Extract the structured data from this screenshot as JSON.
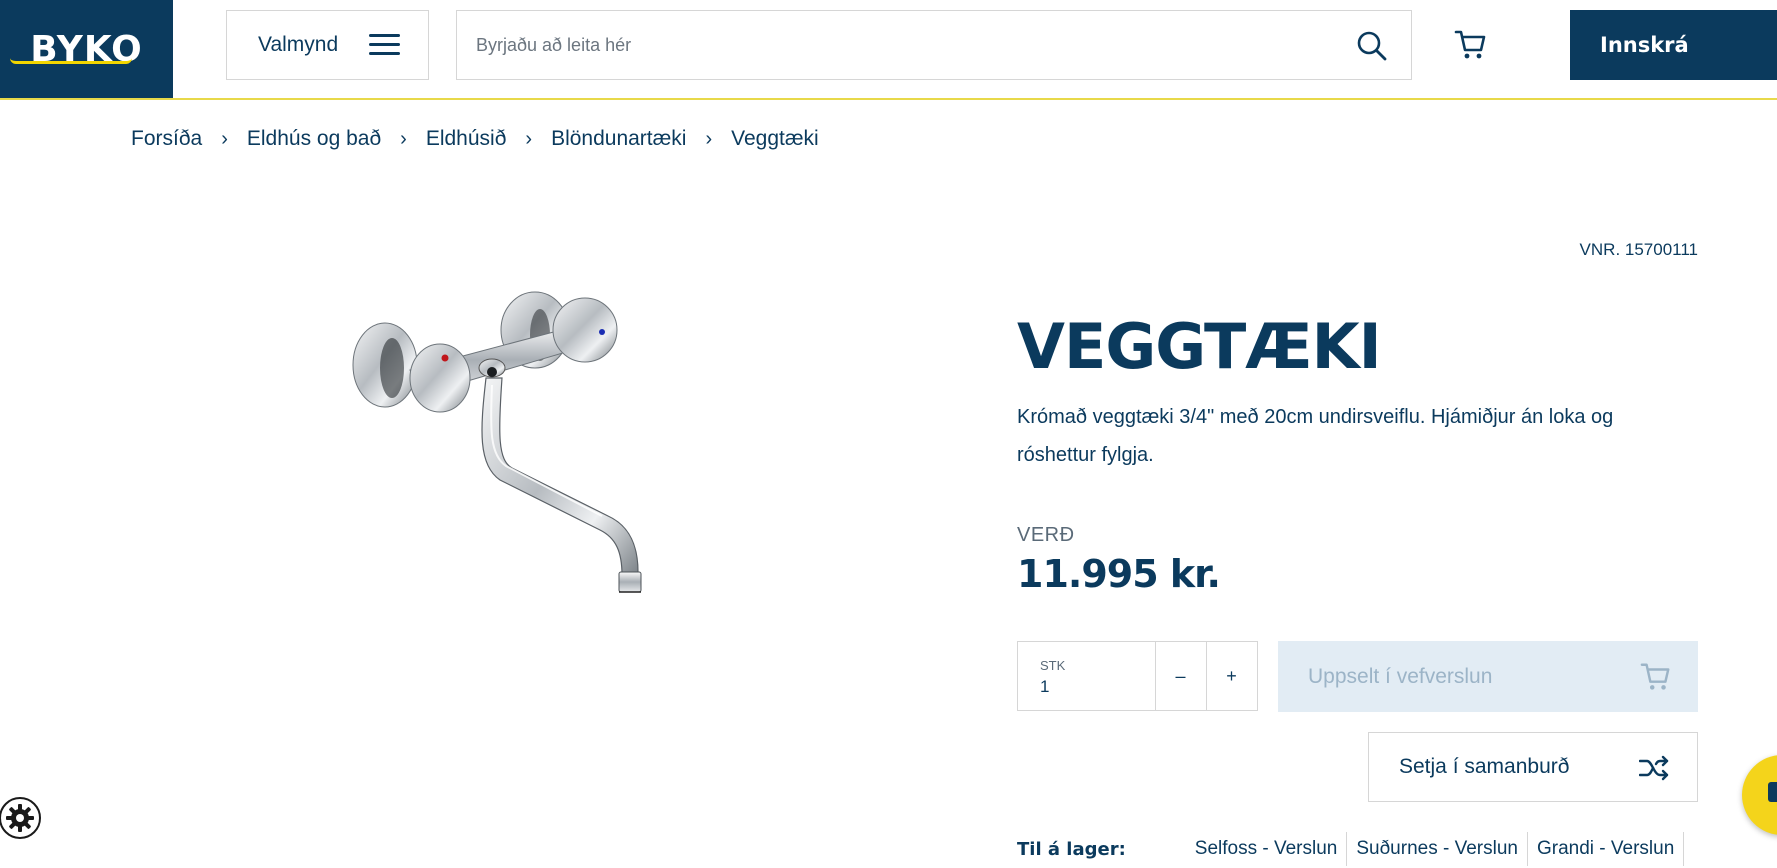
{
  "header": {
    "logo_text": "BYKO",
    "menu_label": "Valmynd",
    "search_placeholder": "Byrjaðu að leita hér",
    "login_label": "Innskrá"
  },
  "breadcrumb": [
    "Forsíða",
    "Eldhús og bað",
    "Eldhúsið",
    "Blöndunartæki",
    "Veggtæki"
  ],
  "product": {
    "vnr": "VNR. 15700111",
    "title": "VEGGTÆKI",
    "description": "Krómað veggtæki 3/4\" með 20cm undirsveiflu. Hjámiðjur án loka og róshettur fylgja.",
    "price_label": "VERÐ",
    "price": "11.995 kr."
  },
  "quantity": {
    "label": "STK",
    "value": "1",
    "minus": "–",
    "plus": "+"
  },
  "buttons": {
    "soldout": "Uppselt í vefverslun",
    "compare": "Setja í samanburð"
  },
  "stock": {
    "label": "Til á lager:",
    "stores": [
      "Selfoss - Verslun",
      "Suðurnes - Verslun",
      "Grandi - Verslun"
    ]
  },
  "colors": {
    "brand": "#0b3a5d",
    "accent": "#f4d41b",
    "soldout_bg": "#e2ecf4"
  }
}
